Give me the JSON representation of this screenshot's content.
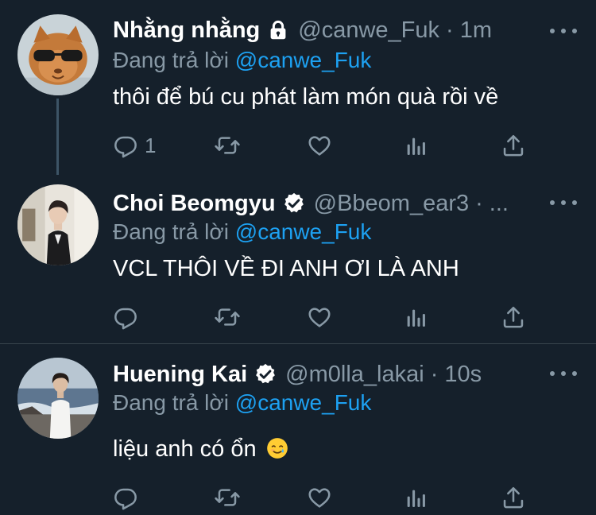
{
  "colors": {
    "background": "#15202b",
    "secondary_text": "#8899a6",
    "link": "#1da1f2",
    "divider": "#38444d"
  },
  "tweets": [
    {
      "name": "Nhằng nhằng",
      "badge_icon": "lock-icon",
      "handle": "@canwe_Fuk",
      "separator": "·",
      "time": "1m",
      "reply_prefix": "Đang trả lời",
      "reply_mention": "@canwe_Fuk",
      "text": "thôi để bú cu phát làm món quà rồi về",
      "reply_count": "1"
    },
    {
      "name": "Choi Beomgyu",
      "badge_icon": "verified-icon",
      "handle": "@Bbeom_ear3",
      "separator": "·",
      "time": "...",
      "reply_prefix": "Đang trả lời",
      "reply_mention": "@canwe_Fuk",
      "text": "VCL THÔI VỀ ĐI ANH ƠI LÀ ANH",
      "reply_count": ""
    },
    {
      "name": "Huening Kai",
      "badge_icon": "verified-icon",
      "handle": "@m0lla_lakai",
      "separator": "·",
      "time": "10s",
      "reply_prefix": "Đang trả lời",
      "reply_mention": "@canwe_Fuk",
      "text": "liệu anh có ổn",
      "text_emoji": "smiling-face-with-tear-emoji",
      "reply_count": ""
    }
  ]
}
